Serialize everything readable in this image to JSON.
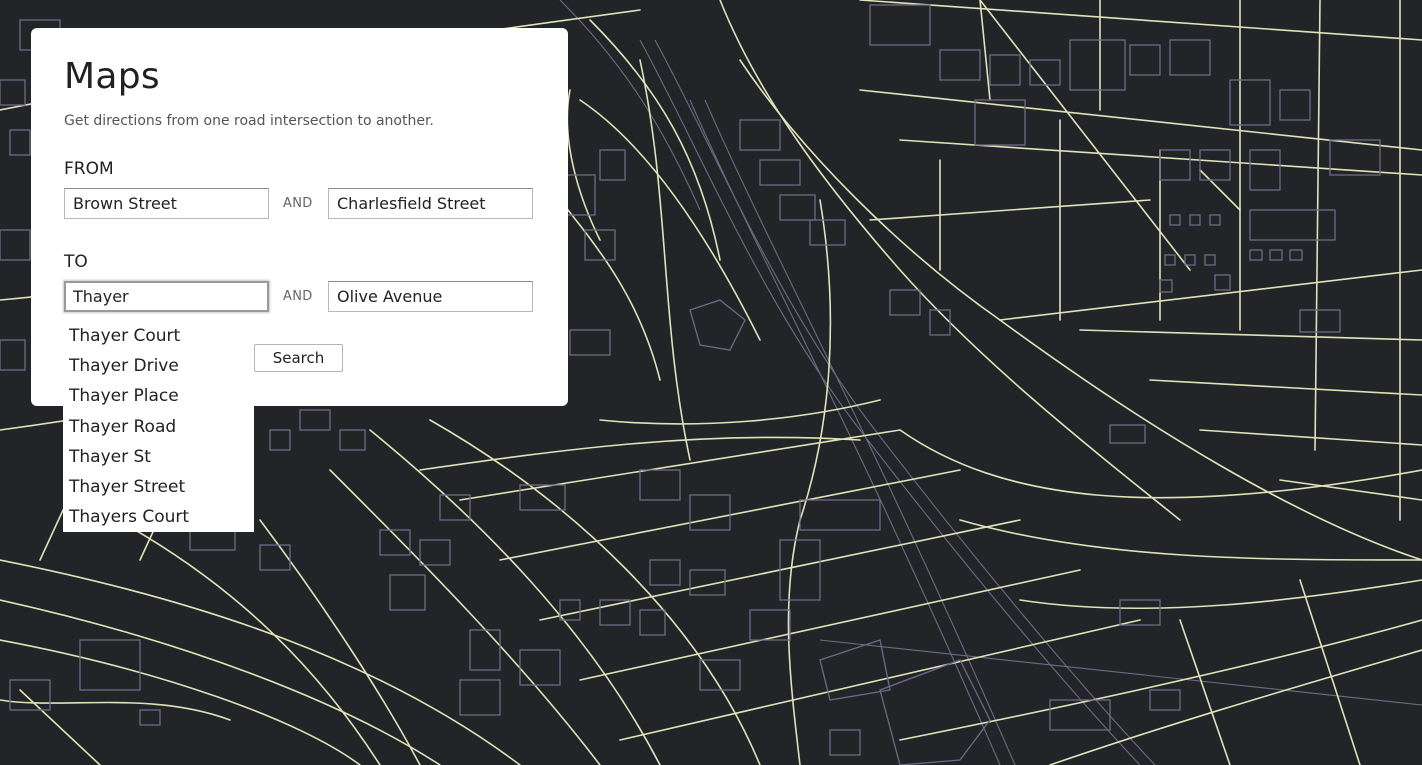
{
  "app": {
    "title": "Maps",
    "subtitle": "Get directions from one road intersection to another."
  },
  "from": {
    "label": "FROM",
    "street1": "Brown Street",
    "and_label": "AND",
    "street2": "Charlesfield Street"
  },
  "to": {
    "label": "TO",
    "street1": "Thayer",
    "and_label": "AND",
    "street2": "Olive Avenue"
  },
  "search_button": "Search",
  "suggestions": [
    "Thayer Court",
    "Thayer Drive",
    "Thayer Place",
    "Thayer Road",
    "Thayer St",
    "Thayer Street",
    "Thayers Court"
  ],
  "colors": {
    "map_background": "#232427",
    "road": "#dfe3b8",
    "building": "#6e6a86",
    "panel": "#ffffff"
  }
}
